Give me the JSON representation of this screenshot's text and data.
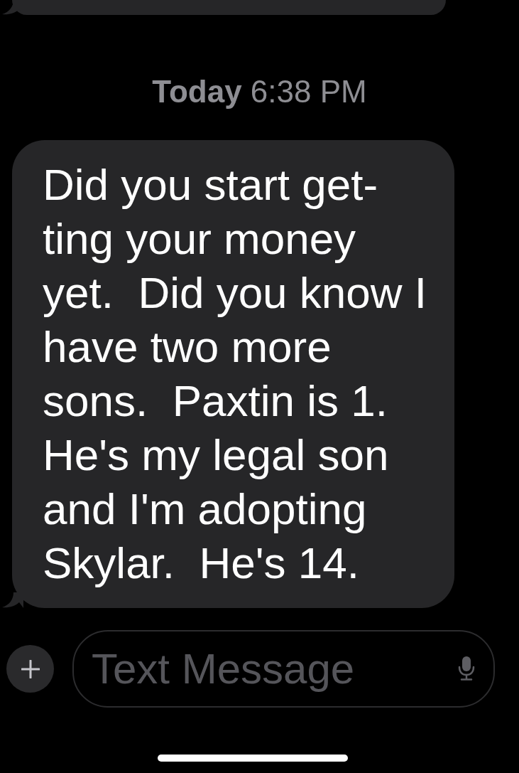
{
  "timestamp": "**Today** 6:38 PM",
  "messages": [
    {
      "kind": "incoming",
      "lines": [
        "Did you start get-",
        "ting your money",
        "yet.  Did you know I",
        "have two more",
        "sons.  Paxtin is 1.",
        "He's my legal son",
        "and I'm adopting",
        "Skylar.  He's 14."
      ]
    }
  ],
  "composer": {
    "placeholder": "Text Message"
  }
}
